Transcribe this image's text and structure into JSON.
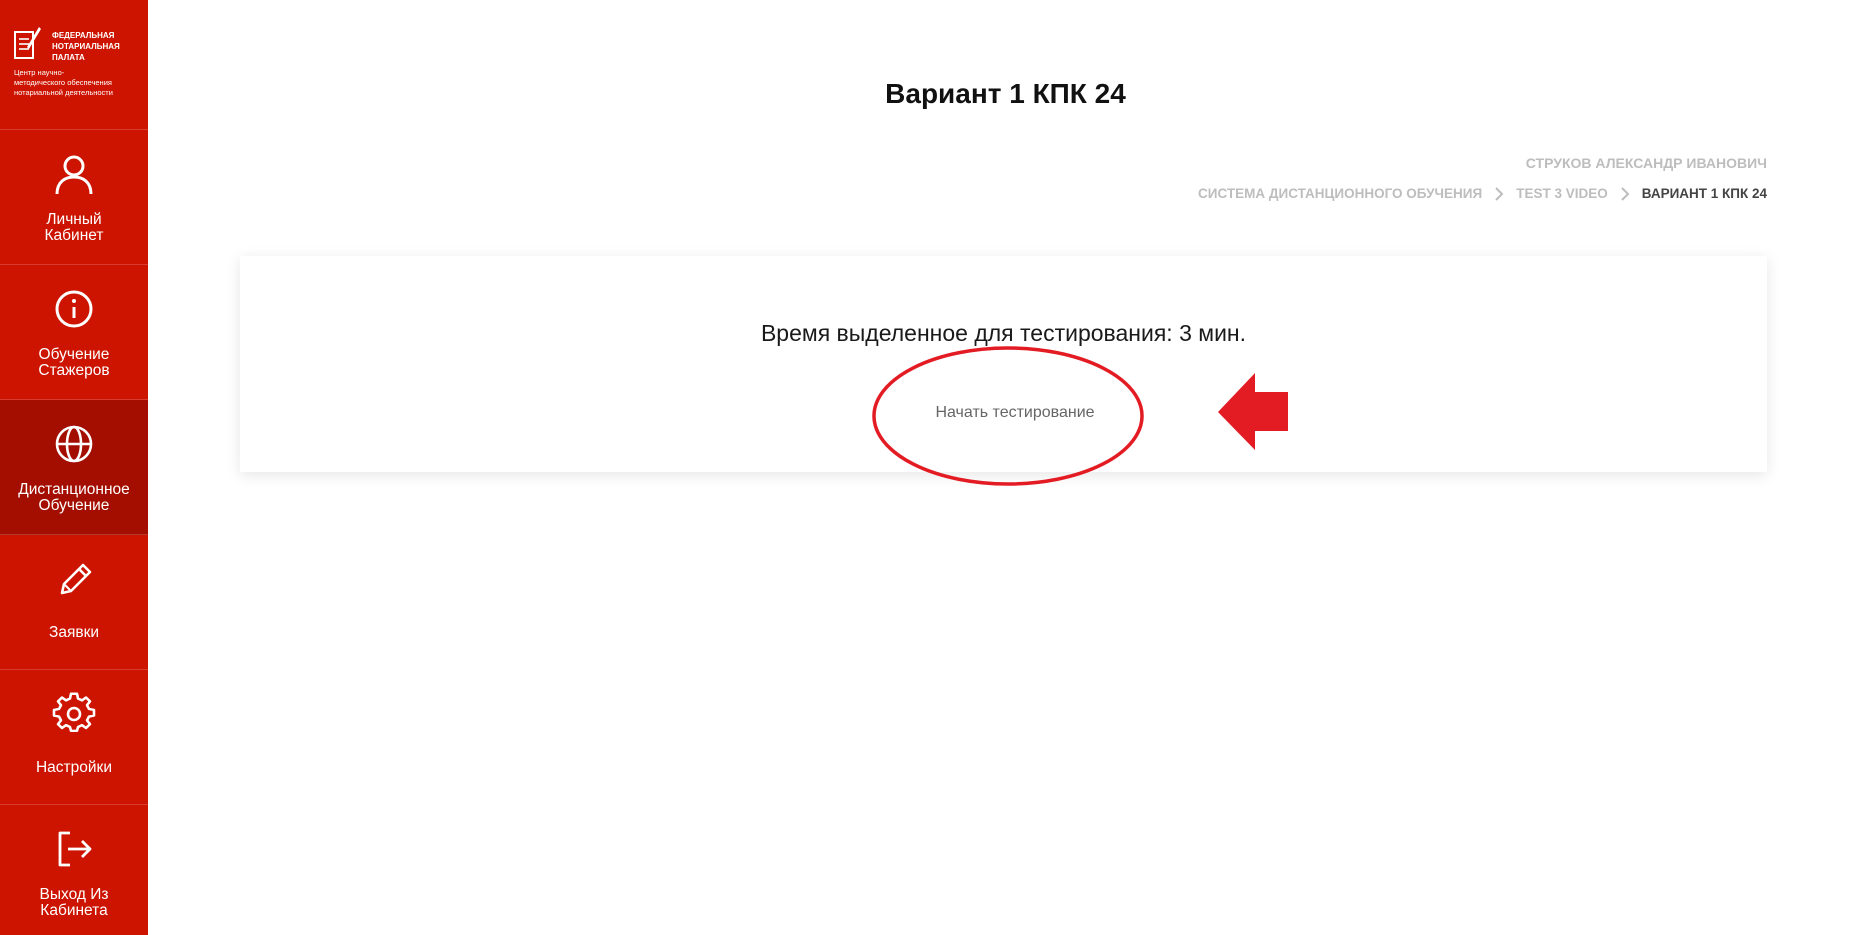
{
  "logo": {
    "org": "Федеральная\nнотариальная\nпалата",
    "sub": "Центр научно-\nметодического обеспечения\nнотариальной деятельности"
  },
  "sidebar": {
    "items": [
      {
        "label": "Личный\nКабинет",
        "icon": "user-icon"
      },
      {
        "label": "Обучение\nСтажеров",
        "icon": "info-icon"
      },
      {
        "label": "Дистанционное\nОбучение",
        "icon": "globe-icon",
        "active": true
      },
      {
        "label": "Заявки",
        "icon": "pencil-icon"
      },
      {
        "label": "Настройки",
        "icon": "gear-icon"
      },
      {
        "label": "Выход Из\nКабинета",
        "icon": "logout-icon"
      }
    ]
  },
  "page": {
    "title": "Вариант 1 КПК 24",
    "user_name": "Струков Александр Иванович"
  },
  "breadcrumb": [
    {
      "label": "Система дистанционного обучения"
    },
    {
      "label": "Test 3 video"
    },
    {
      "label": "Вариант 1 КПК 24",
      "current": true
    }
  ],
  "test_card": {
    "time_text": "Время выделенное для тестирования: 3 мин.",
    "start_label": "Начать тестирование"
  },
  "colors": {
    "sidebar": "#cc1400",
    "sidebar_active": "#a40e00",
    "annotation": "#e31b23"
  }
}
